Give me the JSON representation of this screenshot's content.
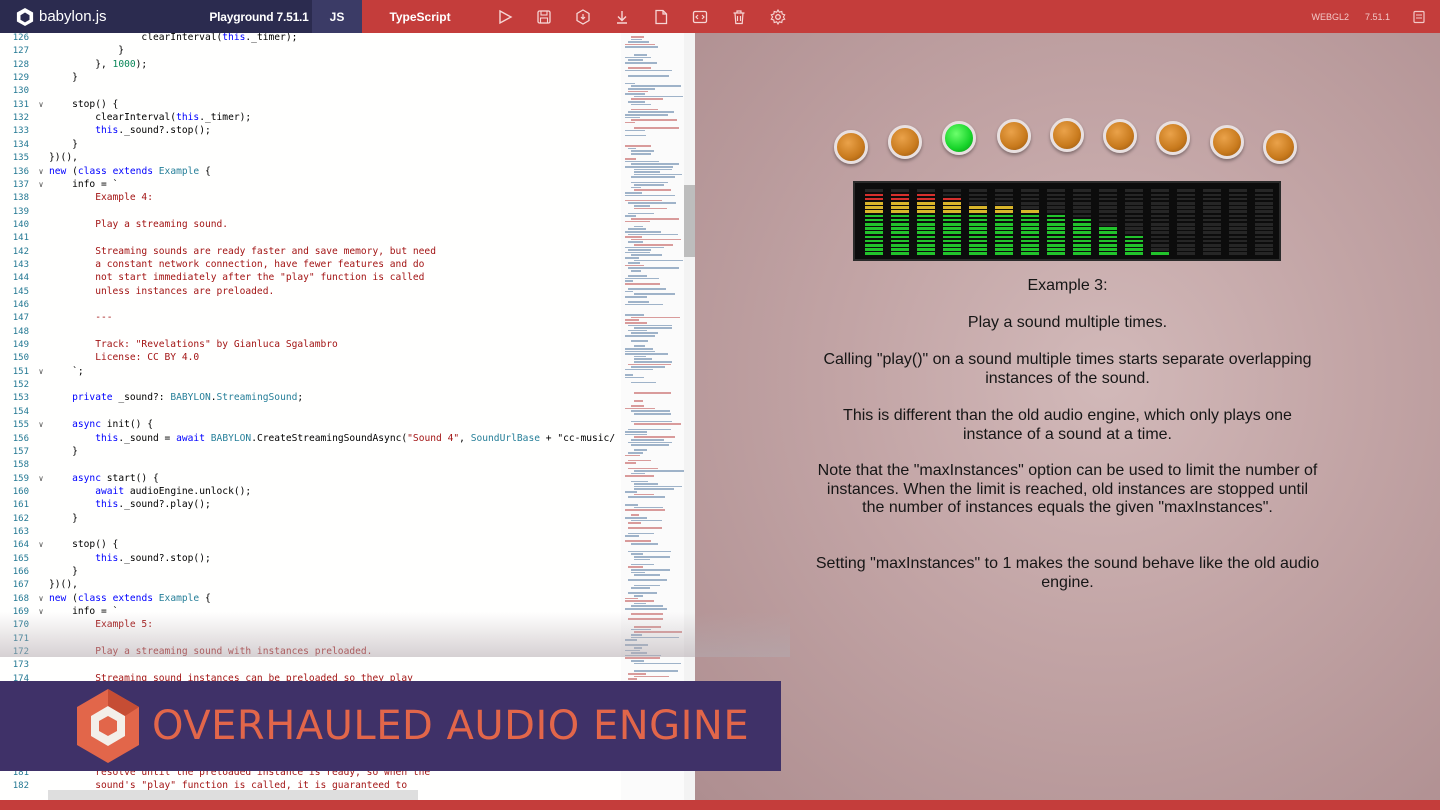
{
  "topbar": {
    "brand": "babylon.js",
    "playground_label": "Playground 7.51.1",
    "tab_js": "JS",
    "tab_ts": "TypeScript",
    "tools": [
      "run-icon",
      "save-icon",
      "download-scene-icon",
      "download-icon",
      "new-file-icon",
      "format-icon",
      "clear-icon",
      "settings-icon"
    ],
    "engine_label": "WEBGL2",
    "version_label": "7.51.1"
  },
  "editor": {
    "lines": [
      {
        "n": "126",
        "f": "",
        "t": "                clearInterval(this._timer);"
      },
      {
        "n": "127",
        "f": "",
        "t": "            }"
      },
      {
        "n": "128",
        "f": "",
        "t": "        }, 1000);"
      },
      {
        "n": "129",
        "f": "",
        "t": "    }"
      },
      {
        "n": "130",
        "f": "",
        "t": ""
      },
      {
        "n": "131",
        "f": "v",
        "t": "    stop() {"
      },
      {
        "n": "132",
        "f": "",
        "t": "        clearInterval(this._timer);"
      },
      {
        "n": "133",
        "f": "",
        "t": "        this._sound?.stop();"
      },
      {
        "n": "134",
        "f": "",
        "t": "    }"
      },
      {
        "n": "135",
        "f": "",
        "t": "})(),"
      },
      {
        "n": "136",
        "f": "v",
        "t": "new (class extends Example {"
      },
      {
        "n": "137",
        "f": "v",
        "t": "    info = `"
      },
      {
        "n": "138",
        "f": "",
        "t": "        Example 4:"
      },
      {
        "n": "139",
        "f": "",
        "t": ""
      },
      {
        "n": "140",
        "f": "",
        "t": "        Play a streaming sound."
      },
      {
        "n": "141",
        "f": "",
        "t": ""
      },
      {
        "n": "142",
        "f": "",
        "t": "        Streaming sounds are ready faster and save memory, but need"
      },
      {
        "n": "143",
        "f": "",
        "t": "        a constant network connection, have fewer features and do"
      },
      {
        "n": "144",
        "f": "",
        "t": "        not start immediately after the \"play\" function is called"
      },
      {
        "n": "145",
        "f": "",
        "t": "        unless instances are preloaded."
      },
      {
        "n": "146",
        "f": "",
        "t": ""
      },
      {
        "n": "147",
        "f": "",
        "t": "        ---"
      },
      {
        "n": "148",
        "f": "",
        "t": ""
      },
      {
        "n": "149",
        "f": "",
        "t": "        Track: \"Revelations\" by Gianluca Sgalambro"
      },
      {
        "n": "150",
        "f": "",
        "t": "        License: CC BY 4.0"
      },
      {
        "n": "151",
        "f": "v",
        "t": "    `;"
      },
      {
        "n": "152",
        "f": "",
        "t": ""
      },
      {
        "n": "153",
        "f": "",
        "t": "    private _sound?: BABYLON.StreamingSound;"
      },
      {
        "n": "154",
        "f": "",
        "t": ""
      },
      {
        "n": "155",
        "f": "v",
        "t": "    async init() {"
      },
      {
        "n": "156",
        "f": "",
        "t": "        this._sound = await BABYLON.CreateStreamingSoundAsync(\"Sound 4\", SoundUrlBase + \"cc-music/"
      },
      {
        "n": "157",
        "f": "",
        "t": "    }"
      },
      {
        "n": "158",
        "f": "",
        "t": ""
      },
      {
        "n": "159",
        "f": "v",
        "t": "    async start() {"
      },
      {
        "n": "160",
        "f": "",
        "t": "        await audioEngine.unlock();"
      },
      {
        "n": "161",
        "f": "",
        "t": "        this._sound?.play();"
      },
      {
        "n": "162",
        "f": "",
        "t": "    }"
      },
      {
        "n": "163",
        "f": "",
        "t": ""
      },
      {
        "n": "164",
        "f": "v",
        "t": "    stop() {"
      },
      {
        "n": "165",
        "f": "",
        "t": "        this._sound?.stop();"
      },
      {
        "n": "166",
        "f": "",
        "t": "    }"
      },
      {
        "n": "167",
        "f": "",
        "t": "})(),"
      },
      {
        "n": "168",
        "f": "v",
        "t": "new (class extends Example {"
      },
      {
        "n": "169",
        "f": "v",
        "t": "    info = `"
      },
      {
        "n": "170",
        "f": "",
        "t": "        Example 5:"
      },
      {
        "n": "171",
        "f": "",
        "t": ""
      },
      {
        "n": "172",
        "f": "",
        "t": "        Play a streaming sound with instances preloaded."
      },
      {
        "n": "173",
        "f": "",
        "t": ""
      },
      {
        "n": "174",
        "f": "",
        "t": "        Streaming sound instances can be preloaded so they play"
      }
    ],
    "tail_lines": [
      {
        "n": "181",
        "f": "",
        "t": "        resolve until the preloaded instance is ready, so when the"
      },
      {
        "n": "182",
        "f": "",
        "t": "        sound's \"play\" function is called, it is guaranteed to"
      }
    ]
  },
  "viewport": {
    "light_states": [
      "off",
      "off",
      "on",
      "off",
      "off",
      "off",
      "off",
      "off",
      "off"
    ],
    "meter_levels": [
      0.92,
      0.93,
      0.92,
      0.88,
      0.78,
      0.74,
      0.7,
      0.62,
      0.56,
      0.45,
      0.32,
      0.06,
      0,
      0,
      0,
      0
    ],
    "colors": {
      "light_off": "#d08524",
      "light_on": "#1ed330",
      "meter_green": "#22c32c",
      "meter_yellow": "#d9b52a",
      "meter_red": "#d6302d"
    },
    "info": {
      "title": "Example 3:",
      "p1": "Play a sound multiple times.",
      "p2": "Calling \"play()\" on a sound multiple times starts separate overlapping instances of the sound.",
      "p3": "This is different than the old audio engine, which only plays one instance of a sound at a time.",
      "p4": "Note that the \"maxInstances\" option can be used to limit the number of instances. When the limit is reached, old instances are stopped until the number of instances equals the given \"maxInstances\".",
      "p5": "Setting \"maxInstances\" to 1 makes the sound behave like the old audio engine."
    }
  },
  "banner": {
    "text": "OVERHAULED AUDIO ENGINE",
    "bg": "#3f3168",
    "accent": "#e2664a"
  }
}
